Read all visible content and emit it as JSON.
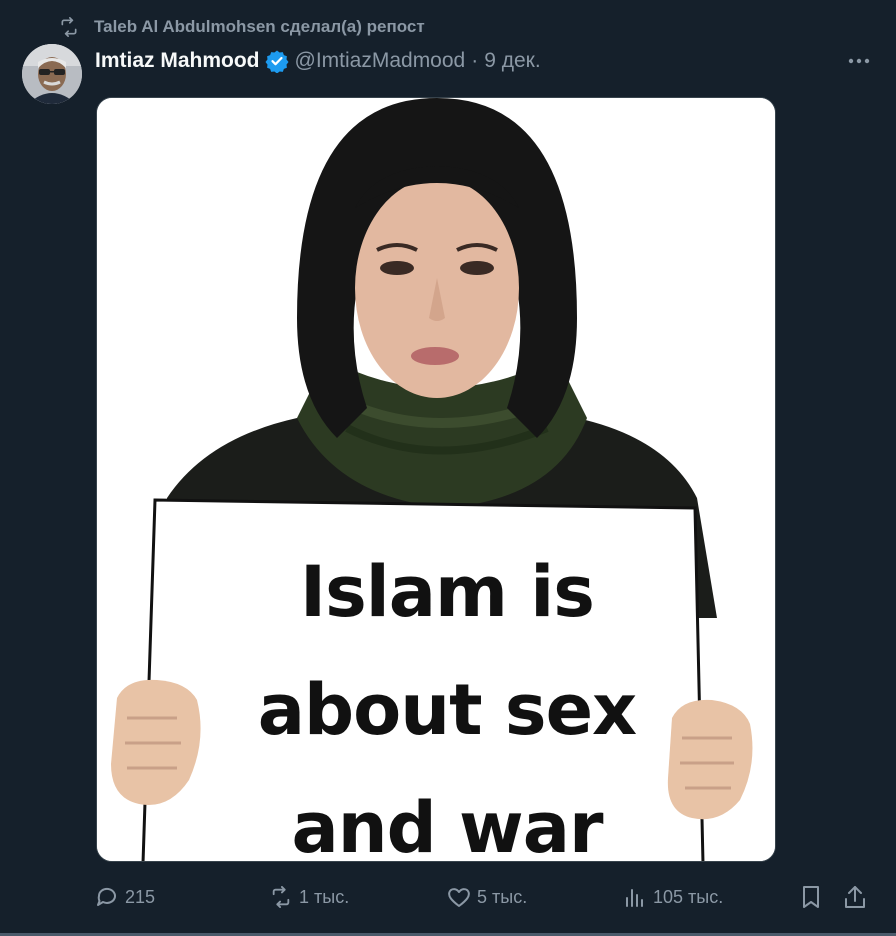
{
  "repost": {
    "label": "Taleb Al Abdulmohsen сделал(а) репост"
  },
  "author": {
    "name": "Imtiaz Mahmood",
    "handle": "@ImtiazMadmood",
    "separator": "·",
    "date": "9 дек."
  },
  "media": {
    "sign_lines": [
      "Islam is",
      "about sex",
      "and war"
    ]
  },
  "actions": {
    "replies": "215",
    "reposts": "1 тыс.",
    "likes": "5 тыс.",
    "views": "105 тыс."
  },
  "icons": {
    "repost": "repost-icon",
    "verified": "verified-badge-icon",
    "more": "more-icon",
    "reply": "reply-icon",
    "like": "heart-icon",
    "views": "views-chart-icon",
    "bookmark": "bookmark-icon",
    "share": "share-icon"
  },
  "colors": {
    "background": "#15202b",
    "muted": "#8b98a5",
    "verified": "#1d9bf0"
  }
}
